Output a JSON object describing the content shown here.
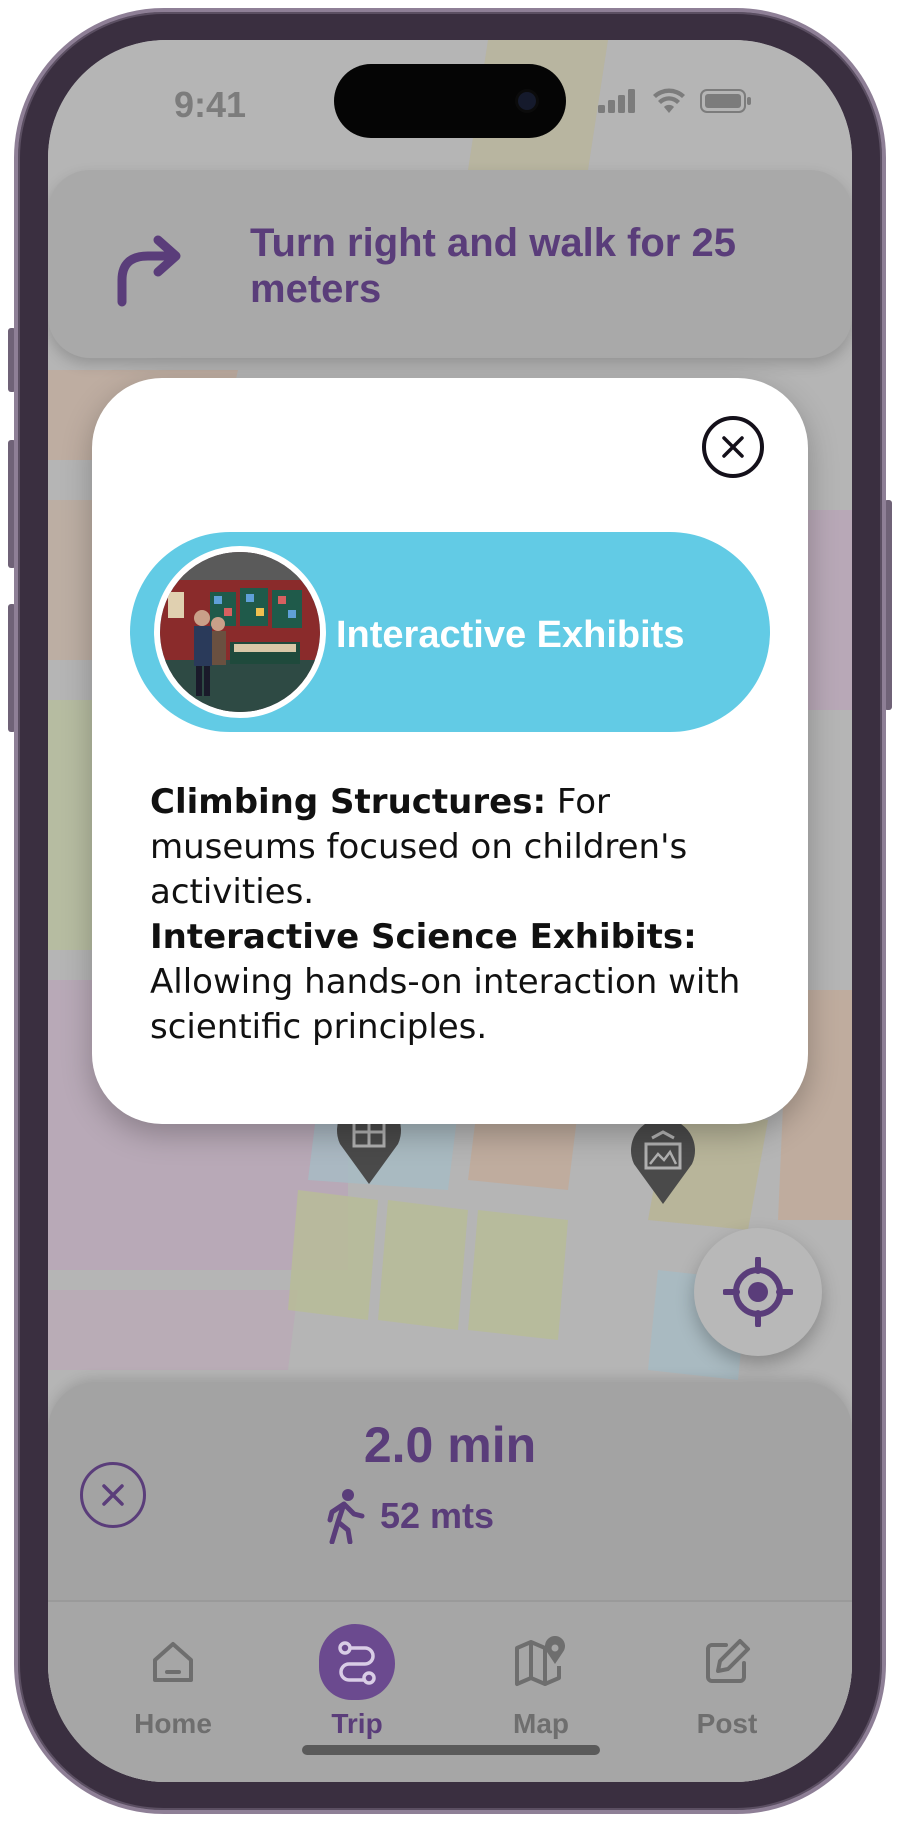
{
  "status_bar": {
    "time": "9:41"
  },
  "navigation": {
    "instruction": "Turn right and walk for 25 meters",
    "icon": "turn-right-arrow-icon"
  },
  "popup": {
    "category_title": "Interactive Exhibits",
    "sections": [
      {
        "heading": "Climbing Structures:",
        "text": " For museums focused on children's activities."
      },
      {
        "heading": "Interactive Science Exhibits:",
        "text": " Allowing hands-on interaction with scientific principles."
      }
    ]
  },
  "trip": {
    "time": "2.0 min",
    "distance": "52 mts",
    "mode_icon": "walking-icon"
  },
  "tabs": [
    {
      "label": "Home",
      "icon": "home-icon",
      "active": false
    },
    {
      "label": "Trip",
      "icon": "route-icon",
      "active": true
    },
    {
      "label": "Map",
      "icon": "map-pin-icon",
      "active": false
    },
    {
      "label": "Post",
      "icon": "edit-icon",
      "active": false
    }
  ],
  "colors": {
    "accent": "#5a3d7a",
    "category_pill": "#62cbe5",
    "overlay_gray": "#b3b3b3"
  }
}
